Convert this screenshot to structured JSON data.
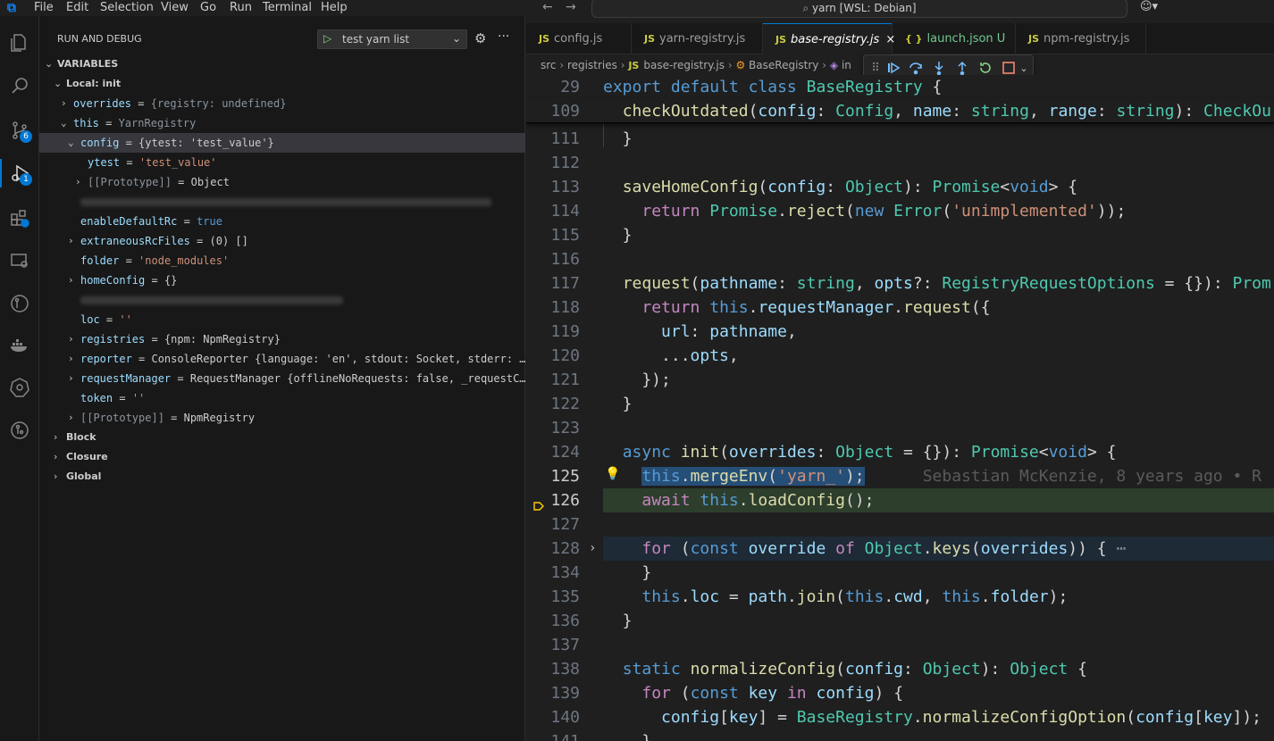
{
  "titlebar": {
    "menu": [
      "File",
      "Edit",
      "Selection",
      "View",
      "Go",
      "Run",
      "Terminal",
      "Help"
    ],
    "search_text": "yarn [WSL: Debian]"
  },
  "activity": {
    "source_control_badge": "6",
    "debug_badge": "1"
  },
  "sidebar": {
    "title": "RUN AND DEBUG",
    "launch_config": "test yarn list",
    "variables_header": "VARIABLES",
    "scope_local": "Local: init",
    "scopes_other": [
      "Block",
      "Closure",
      "Global"
    ],
    "vars": {
      "overrides": {
        "name": "overrides",
        "value": "{registry: undefined}"
      },
      "this": {
        "name": "this",
        "value": "YarnRegistry"
      },
      "config": {
        "name": "config",
        "value": "{ytest: 'test_value'}"
      },
      "ytest": {
        "name": "ytest",
        "value": "'test_value'"
      },
      "config_proto": {
        "name": "[[Prototype]]",
        "value": "Object"
      },
      "enableDefaultRc": {
        "name": "enableDefaultRc",
        "value": "true"
      },
      "extraneousRcFiles": {
        "name": "extraneousRcFiles",
        "value": "(0) []"
      },
      "folder": {
        "name": "folder",
        "value": "'node_modules'"
      },
      "homeConfig": {
        "name": "homeConfig",
        "value": "{}"
      },
      "loc": {
        "name": "loc",
        "value": "''"
      },
      "registries": {
        "name": "registries",
        "value": "{npm: NpmRegistry}"
      },
      "reporter": {
        "name": "reporter",
        "value": "ConsoleReporter {language: 'en', stdout: Socket, stderr: …"
      },
      "requestManager": {
        "name": "requestManager",
        "value": "RequestManager {offlineNoRequests: false, _requestC…"
      },
      "token": {
        "name": "token",
        "value": "''"
      },
      "this_proto": {
        "name": "[[Prototype]]",
        "value": "NpmRegistry"
      }
    }
  },
  "tabs": [
    {
      "label": "config.js",
      "icon": "JS"
    },
    {
      "label": "yarn-registry.js",
      "icon": "JS"
    },
    {
      "label": "base-registry.js",
      "icon": "JS",
      "close": "×"
    },
    {
      "label": "launch.json",
      "icon": "{ }",
      "status": "U"
    },
    {
      "label": "npm-registry.js",
      "icon": "JS"
    }
  ],
  "breadcrumb": [
    "src",
    "registries",
    "base-registry.js",
    "BaseRegistry",
    "in"
  ],
  "editor": {
    "lines": [
      {
        "n": "29"
      },
      {
        "n": "109"
      },
      {
        "n": "111"
      },
      {
        "n": "112"
      },
      {
        "n": "113"
      },
      {
        "n": "114"
      },
      {
        "n": "115"
      },
      {
        "n": "116"
      },
      {
        "n": "117"
      },
      {
        "n": "118"
      },
      {
        "n": "119"
      },
      {
        "n": "120"
      },
      {
        "n": "121"
      },
      {
        "n": "122"
      },
      {
        "n": "123"
      },
      {
        "n": "124"
      },
      {
        "n": "125"
      },
      {
        "n": "126"
      },
      {
        "n": "127"
      },
      {
        "n": "128"
      },
      {
        "n": "134"
      },
      {
        "n": "135"
      },
      {
        "n": "136"
      },
      {
        "n": "137"
      },
      {
        "n": "138"
      },
      {
        "n": "139"
      },
      {
        "n": "140"
      },
      {
        "n": "141"
      }
    ],
    "blame": "Sebastian McKenzie, 8 years ago • R",
    "fold_ellipsis": "⋯"
  },
  "colors": {
    "accent": "#0078d4",
    "current_line": "#2d3e2d",
    "keyword": "#569cd6",
    "string": "#ce9178",
    "function": "#dcdcaa",
    "class": "#4ec9b0"
  }
}
